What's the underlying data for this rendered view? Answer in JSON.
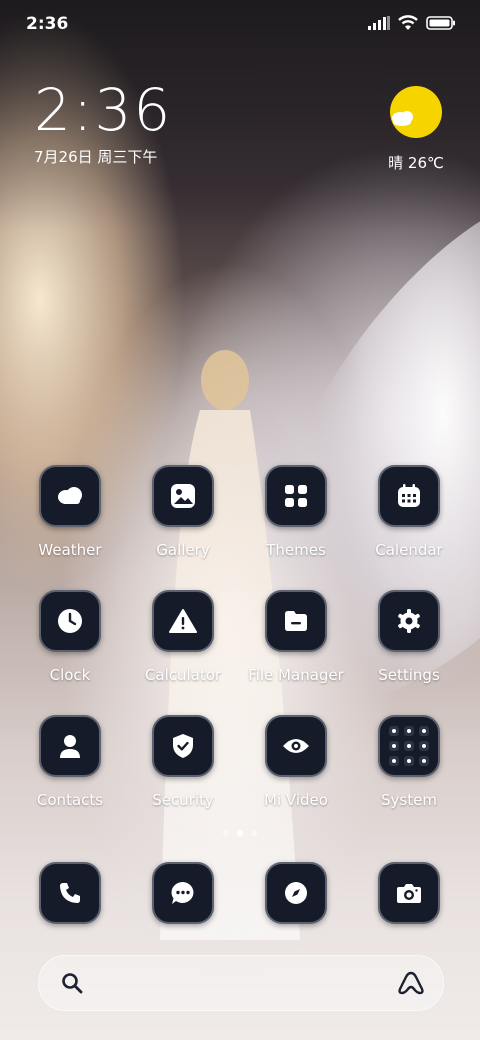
{
  "status_bar": {
    "time": "2:36"
  },
  "clock_widget": {
    "time": "2:36",
    "date": "7月26日 周三下午"
  },
  "weather_widget": {
    "condition_temp": "晴 26℃",
    "icon": "sun-cloud-icon",
    "sun_color": "#f5d400"
  },
  "apps": [
    {
      "label": "Weather",
      "icon": "cloud-icon"
    },
    {
      "label": "Gallery",
      "icon": "image-icon"
    },
    {
      "label": "Themes",
      "icon": "grid-icon"
    },
    {
      "label": "Calendar",
      "icon": "calendar-icon"
    },
    {
      "label": "Clock",
      "icon": "clock-icon"
    },
    {
      "label": "Calculator",
      "icon": "warning-icon"
    },
    {
      "label": "File Manager",
      "icon": "folder-icon"
    },
    {
      "label": "Settings",
      "icon": "gear-icon"
    },
    {
      "label": "Contacts",
      "icon": "person-icon"
    },
    {
      "label": "Security",
      "icon": "shield-icon"
    },
    {
      "label": "Mi Video",
      "icon": "eye-icon"
    },
    {
      "label": "System",
      "icon": "folder-grid-icon"
    }
  ],
  "dock": [
    {
      "icon": "phone-icon"
    },
    {
      "icon": "message-icon"
    },
    {
      "icon": "compass-icon"
    },
    {
      "icon": "camera-icon"
    }
  ],
  "page_indicator": {
    "pages": 3,
    "active": 2
  },
  "search_bar": {
    "left_icon": "search-icon",
    "right_icon": "assistant-icon"
  },
  "colors": {
    "tile_bg": "#161b29",
    "tile_border": "#5c6270"
  }
}
